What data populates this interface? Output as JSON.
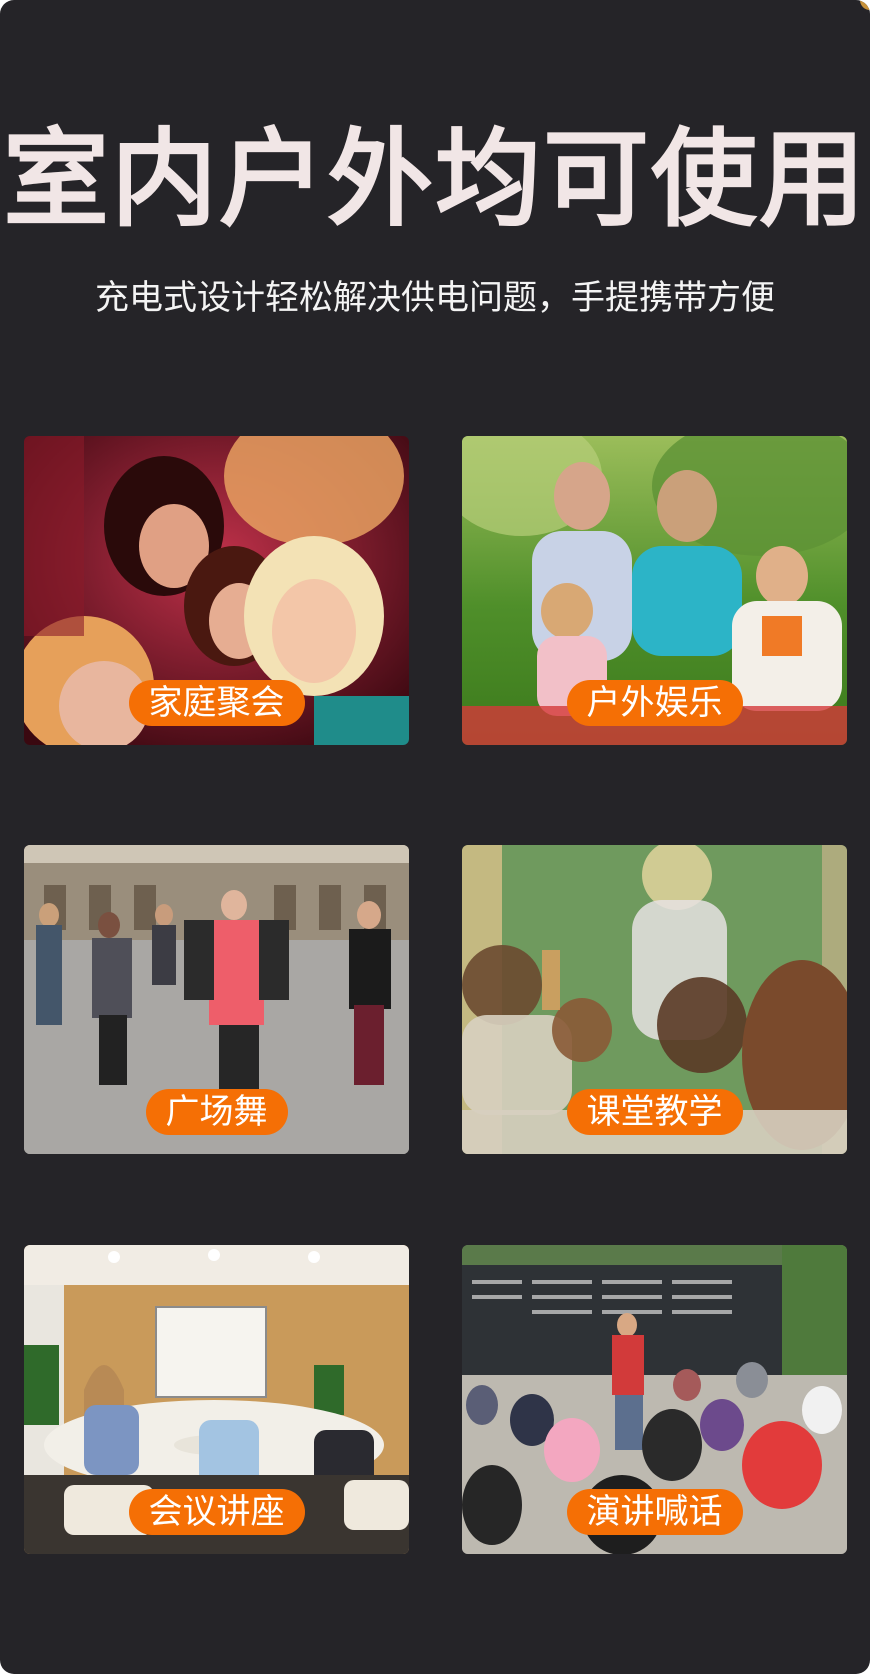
{
  "title": "室内户外均可使用",
  "subtitle": "充电式设计轻松解决供电问题，手提携带方便",
  "accent_color": "#f56f05",
  "background_color": "#252428",
  "scenes": [
    {
      "label": "家庭聚会"
    },
    {
      "label": "户外娱乐"
    },
    {
      "label": "广场舞"
    },
    {
      "label": "课堂教学"
    },
    {
      "label": "会议讲座"
    },
    {
      "label": "演讲喊话"
    }
  ]
}
